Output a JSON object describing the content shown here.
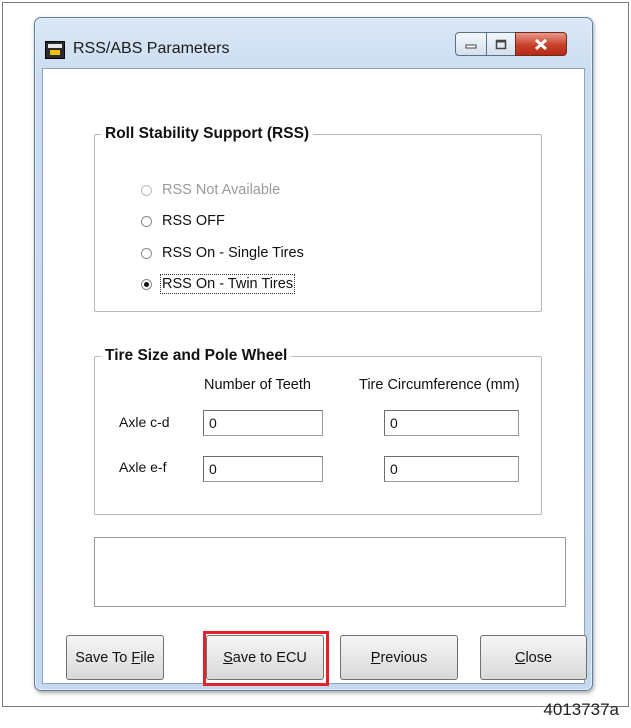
{
  "window": {
    "title": "RSS/ABS Parameters",
    "icon": "rss-app-icon"
  },
  "rss": {
    "legend": "Roll Stability Support (RSS)",
    "options": [
      {
        "label": "RSS Not Available",
        "state": "disabled"
      },
      {
        "label": "RSS OFF",
        "state": "unchecked"
      },
      {
        "label": "RSS On - Single Tires",
        "state": "unchecked"
      },
      {
        "label": "RSS On - Twin Tires",
        "state": "checked"
      }
    ]
  },
  "tire": {
    "legend": "Tire Size and Pole Wheel",
    "col_teeth": "Number of Teeth",
    "col_circ": "Tire Circumference (mm)",
    "rows": [
      {
        "label": "Axle c-d",
        "teeth": "0",
        "circ": "0"
      },
      {
        "label": "Axle e-f",
        "teeth": "0",
        "circ": "0"
      }
    ]
  },
  "message": "",
  "buttons": {
    "save_file_pre": "Save To ",
    "save_file_key": "F",
    "save_file_post": "ile",
    "save_ecu_key": "S",
    "save_ecu_post": "ave to ECU",
    "previous_key": "P",
    "previous_post": "revious",
    "close_key": "C",
    "close_post": "lose"
  },
  "figure_id": "4013737a",
  "colors": {
    "highlight": "#e0222a",
    "close_button": "#c8402a"
  }
}
